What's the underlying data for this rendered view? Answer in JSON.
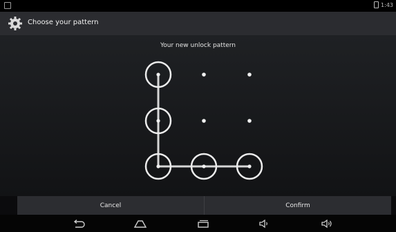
{
  "statusbar": {
    "time": "1:43"
  },
  "actionbar": {
    "title": "Choose your pattern"
  },
  "main": {
    "headline": "Your new unlock pattern"
  },
  "pattern": {
    "grid": "3x3",
    "selected_sequence": [
      1,
      4,
      7,
      8,
      9
    ]
  },
  "buttons": {
    "cancel": "Cancel",
    "confirm": "Confirm"
  },
  "navbar": {
    "icons": [
      "back-icon",
      "home-icon",
      "recent-apps-icon",
      "volume-down-icon",
      "volume-up-icon"
    ]
  },
  "colors": {
    "actionbar": "#2b2c30",
    "background": "#121315",
    "pattern": "#e6e6e6"
  }
}
